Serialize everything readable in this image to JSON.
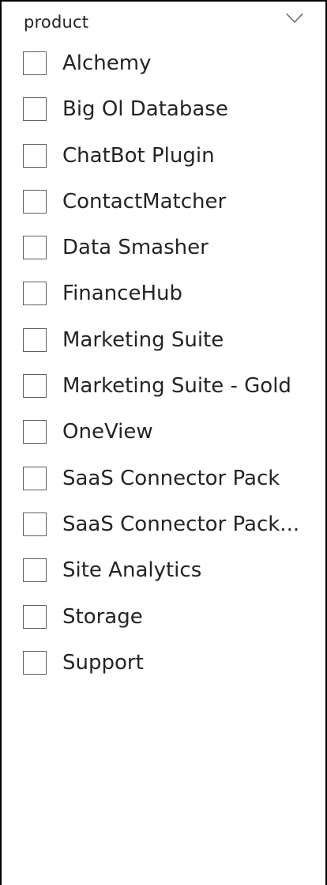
{
  "slicer": {
    "title": "product",
    "dropdown_icon": "chevron-down-icon",
    "accent_color": "#252423",
    "items": [
      {
        "label": "Alchemy",
        "checked": false
      },
      {
        "label": "Big Ol Database",
        "checked": false
      },
      {
        "label": "ChatBot Plugin",
        "checked": false
      },
      {
        "label": "ContactMatcher",
        "checked": false
      },
      {
        "label": "Data Smasher",
        "checked": false
      },
      {
        "label": "FinanceHub",
        "checked": false
      },
      {
        "label": "Marketing Suite",
        "checked": false
      },
      {
        "label": "Marketing Suite - Gold",
        "checked": false
      },
      {
        "label": "OneView",
        "checked": false
      },
      {
        "label": "SaaS Connector Pack",
        "checked": false
      },
      {
        "label": "SaaS Connector Pack...",
        "checked": false
      },
      {
        "label": "Site Analytics",
        "checked": false
      },
      {
        "label": "Storage",
        "checked": false
      },
      {
        "label": "Support",
        "checked": false
      }
    ]
  }
}
